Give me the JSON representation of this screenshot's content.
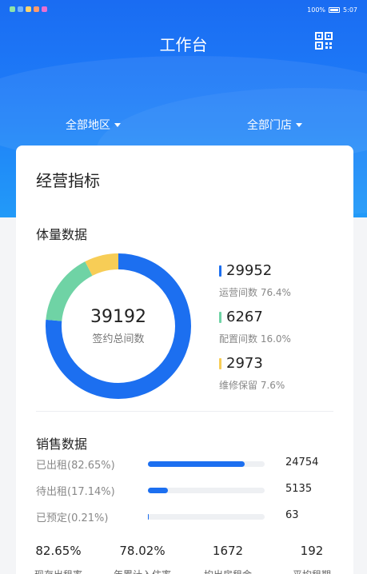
{
  "status_bar": {
    "battery": "100%",
    "time": "5:07"
  },
  "header": {
    "title": "工作台",
    "qr_icon": "qr-code-icon"
  },
  "filters": {
    "region": "全部地区",
    "store": "全部门店"
  },
  "card": {
    "title": "经营指标",
    "volume": {
      "title": "体量数据",
      "total": "39192",
      "total_label": "签约总间数",
      "items": [
        {
          "value": "29952",
          "label": "运营间数 76.4%",
          "color": "#1c6ff0",
          "fraction": 0.764
        },
        {
          "value": "6267",
          "label": "配置间数 16.0%",
          "color": "#6fd3a5",
          "fraction": 0.16
        },
        {
          "value": "2973",
          "label": "维修保留 7.6%",
          "color": "#f7cd56",
          "fraction": 0.076
        }
      ]
    },
    "sales": {
      "title": "销售数据",
      "items": [
        {
          "label": "已出租(82.65%)",
          "value": "24754",
          "fraction": 0.8265
        },
        {
          "label": "待出租(17.14%)",
          "value": "5135",
          "fraction": 0.1714
        },
        {
          "label": "已预定(0.21%)",
          "value": "63",
          "fraction": 0.0021
        }
      ]
    },
    "stats": [
      {
        "value": "82.65%",
        "label": "现存出租率"
      },
      {
        "value": "78.02%",
        "label": "年累计入住率"
      },
      {
        "value": "1672",
        "label": "均出房租金"
      },
      {
        "value": "192",
        "label": "平均租期"
      }
    ]
  }
}
